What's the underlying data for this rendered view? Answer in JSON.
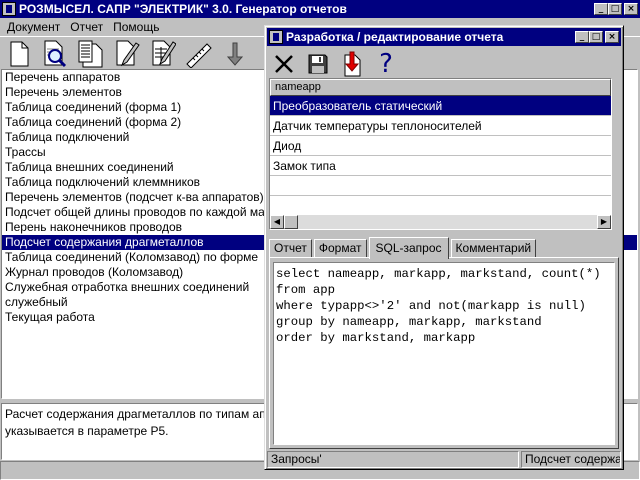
{
  "main_window": {
    "title": "РОЗМЫСЕЛ. САПР \"ЭЛЕКТРИК\" 3.0. Генератор отчетов",
    "controls": {
      "minimize": "_",
      "maximize": "□",
      "close": "×"
    }
  },
  "menu": [
    "Документ",
    "Отчет",
    "Помощь"
  ],
  "toolbar": [
    "new-document-icon",
    "preview-icon",
    "report-icon",
    "edit-icon",
    "edit-table-icon",
    "ruler-icon",
    "arrow-down-icon"
  ],
  "reports": {
    "selected_index": 11,
    "items": [
      "Перечень аппаратов",
      "Перечень элементов",
      "Таблица соединений (форма 1)",
      "Таблица соединений (форма 2)",
      "Таблица подключений",
      "Трассы",
      "Таблица внешних соединений",
      "Таблица подключений клеммников",
      "Перечень элементов (подсчет к-ва аппаратов)",
      "Подсчет общей длины проводов по каждой марке",
      "Перень наконечников проводов",
      "Подсчет содержания драгметаллов",
      "Таблица соединений (Коломзавод) по форме",
      "Журнал проводов (Коломзавод)",
      "Служебная отработка внешних соединений",
      "служебный",
      "Текущая работа"
    ]
  },
  "description": {
    "line1": "Расчет содержания драгметаллов по типам аппаратов",
    "line2": "указывается в параметре Р5."
  },
  "dialog": {
    "title": "Разработка / редактирование отчета",
    "controls": {
      "minimize": "_",
      "maximize": "□",
      "close": "×"
    },
    "toolbar": [
      "close-x-icon",
      "save-icon",
      "export-icon",
      "help-question-icon"
    ],
    "help_glyph": "?",
    "grid": {
      "column": "nameapp",
      "selected_index": 0,
      "rows": [
        "Преобразователь статический",
        "Датчик температуры теплоносителей",
        "Диод",
        "Замок типа",
        ""
      ]
    },
    "tabs": [
      "Отчет",
      "Формат",
      "SQL-запрос",
      "Комментарий"
    ],
    "active_tab": 2,
    "sql_lines": [
      "select nameapp, markapp, markstand, count(*)",
      "from app",
      "where typapp<>'2' and not(markapp is null)",
      "group by nameapp, markapp, markstand",
      "order by markstand, markapp"
    ],
    "status": {
      "left": "Запросы'",
      "right": "Подсчет содержания драгметаллов"
    }
  }
}
